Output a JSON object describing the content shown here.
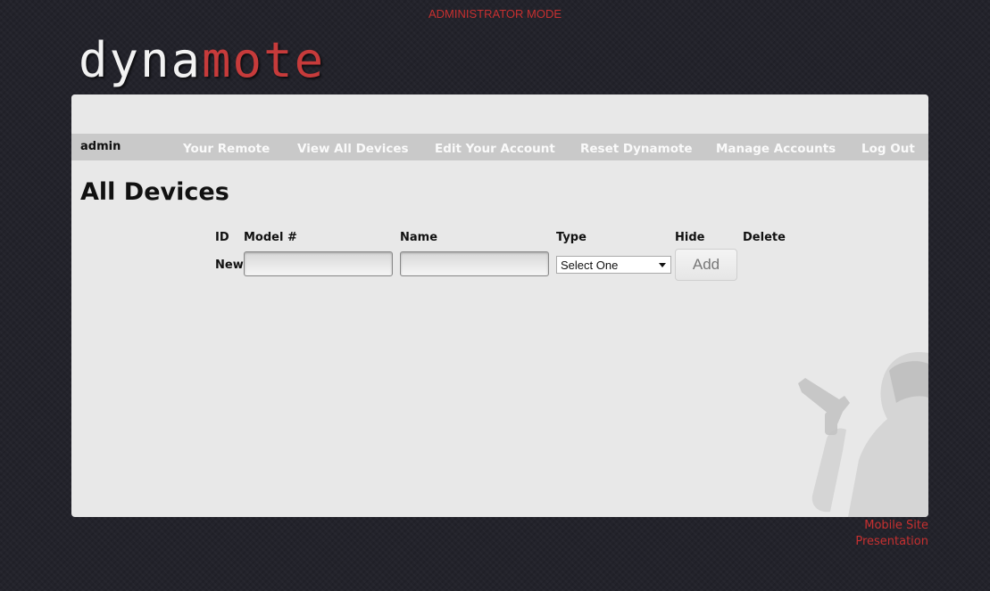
{
  "header": {
    "mode_label": "ADMINISTRATOR MODE",
    "logo": {
      "part1": "dyna",
      "part2": "mote"
    }
  },
  "nav": {
    "user": "admin",
    "links": [
      "Your Remote",
      "View All Devices",
      "Edit Your Account",
      "Reset Dynamote",
      "Manage Accounts",
      "Log Out"
    ]
  },
  "main": {
    "title": "All Devices",
    "columns": [
      "ID",
      "Model #",
      "Name",
      "Type",
      "Hide",
      "Delete"
    ],
    "new_row": {
      "id_label": "New",
      "model_value": "",
      "name_value": "",
      "type_selected": "Select One",
      "add_label": "Add"
    }
  },
  "footer": {
    "links": [
      "Mobile Site",
      "Presentation"
    ]
  },
  "colors": {
    "accent": "#c73030",
    "background": "#23232b",
    "panel": "#e8e8e8",
    "nav": "#c9c9c9"
  }
}
